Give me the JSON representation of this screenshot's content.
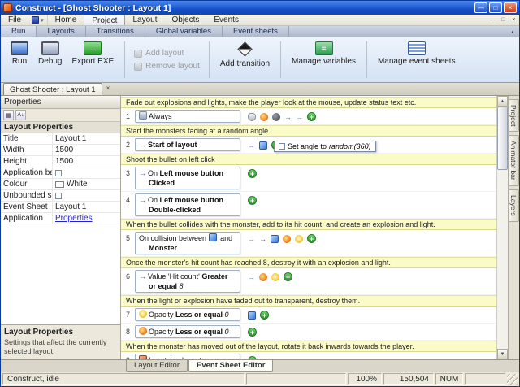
{
  "window": {
    "title": "Construct - [Ghost Shooter : Layout 1]"
  },
  "menu": {
    "items": [
      "File",
      "Home",
      "Project",
      "Layout",
      "Objects",
      "Events"
    ],
    "active_index": 2
  },
  "ribbon": {
    "groups": [
      "Run",
      "Layouts",
      "Transitions",
      "Global variables",
      "Event sheets"
    ],
    "buttons": [
      {
        "label": "Run",
        "icon": "run-icon"
      },
      {
        "label": "Debug",
        "icon": "debug-icon"
      },
      {
        "label": "Export EXE",
        "icon": "export-icon"
      },
      {
        "label": "Add layout",
        "icon": "add-layout-icon",
        "disabled": true
      },
      {
        "label": "Remove layout",
        "icon": "remove-layout-icon",
        "disabled": true
      },
      {
        "label": "Add transition",
        "icon": "transition-icon"
      },
      {
        "label": "Manage variables",
        "icon": "variables-icon"
      },
      {
        "label": "Manage event sheets",
        "icon": "event-sheets-icon"
      }
    ]
  },
  "doc_tab": {
    "label": "Ghost Shooter : Layout 1"
  },
  "properties": {
    "title": "Properties",
    "group_header": "Layout Properties",
    "rows": [
      {
        "name": "Title",
        "kind": "text",
        "value": "Layout 1"
      },
      {
        "name": "Width",
        "kind": "text",
        "value": "1500"
      },
      {
        "name": "Height",
        "kind": "text",
        "value": "1500"
      },
      {
        "name": "Application backg",
        "kind": "check",
        "checked": false
      },
      {
        "name": "Colour",
        "kind": "color",
        "value": "White",
        "swatch": "#ffffff"
      },
      {
        "name": "Unbounded scrolli",
        "kind": "check",
        "checked": false
      },
      {
        "name": "Event Sheet",
        "kind": "text",
        "value": "Layout 1"
      },
      {
        "name": "Application",
        "kind": "link",
        "value": "Properties"
      }
    ],
    "footer_title": "Layout Properties",
    "footer_desc": "Settings that affect the currently selected layout"
  },
  "events": [
    {
      "kind": "comment",
      "text": "Fade out explosions and lights, make the player look at the mouse, update status text etc."
    },
    {
      "kind": "event",
      "num": "1",
      "lines": [
        [
          {
            "icon": "system-icon"
          },
          {
            "t": "Always"
          }
        ]
      ],
      "actions": [
        "mouse-icon",
        "explosion-icon",
        "ball-icon",
        "arrow-icon",
        "arrow-icon"
      ]
    },
    {
      "kind": "comment",
      "text": "Start the monsters facing at a random angle."
    },
    {
      "kind": "event",
      "num": "2",
      "lines": [
        [
          {
            "icon": "arrow-icon"
          },
          {
            "t": "Start of layout",
            "b": true
          }
        ]
      ],
      "actions": [
        "arrow-icon",
        "sprite-icon"
      ],
      "popup": {
        "text_parts": [
          {
            "t": "Set angle to "
          },
          {
            "t": "random(360)",
            "i": true
          }
        ]
      }
    },
    {
      "kind": "comment",
      "text": "Shoot the bullet on left click"
    },
    {
      "kind": "event",
      "num": "3",
      "lines": [
        [
          {
            "icon": "arrow-icon"
          },
          {
            "t": "On "
          },
          {
            "t": "Left mouse button",
            "b": true
          }
        ],
        [
          {
            "t": "Clicked",
            "b": true
          }
        ]
      ],
      "actions": []
    },
    {
      "kind": "event",
      "num": "4",
      "lines": [
        [
          {
            "icon": "arrow-icon"
          },
          {
            "t": "On "
          },
          {
            "t": "Left mouse button",
            "b": true
          }
        ],
        [
          {
            "t": "Double-clicked",
            "b": true
          }
        ]
      ],
      "actions": []
    },
    {
      "kind": "comment",
      "text": "When the bullet collides with the monster, add to its hit count, and create an explosion and light."
    },
    {
      "kind": "event",
      "num": "5",
      "lines": [
        [
          {
            "t": "On collision between "
          },
          {
            "icon": "sprite-icon"
          },
          {
            "t": " and"
          }
        ],
        [
          {
            "t": "Monster",
            "b": true
          }
        ]
      ],
      "actions": [
        "arrow-icon",
        "arrow-icon",
        "sprite-icon",
        "explosion-icon",
        "light-icon"
      ]
    },
    {
      "kind": "comment",
      "text": "Once the monster's hit count has reached 8, destroy it with an explosion and light."
    },
    {
      "kind": "event",
      "num": "6",
      "lines": [
        [
          {
            "icon": "arrow-icon"
          },
          {
            "t": "Value 'Hit count' "
          },
          {
            "t": "Greater",
            "b": true
          }
        ],
        [
          {
            "t": "or equal ",
            "b": true
          },
          {
            "t": "8",
            "i": true
          }
        ]
      ],
      "actions": [
        "arrow-icon",
        "explosion-icon",
        "light-icon"
      ]
    },
    {
      "kind": "comment",
      "text": "When the light or explosion have faded out to transparent, destroy them."
    },
    {
      "kind": "event",
      "num": "7",
      "lines": [
        [
          {
            "icon": "light-icon"
          },
          {
            "t": "Opacity "
          },
          {
            "t": "Less or equal",
            "b": true
          },
          {
            "t": " 0",
            "i": true
          }
        ]
      ],
      "actions": [
        "sprite-icon"
      ]
    },
    {
      "kind": "event",
      "num": "8",
      "lines": [
        [
          {
            "icon": "explosion-icon"
          },
          {
            "t": "Opacity "
          },
          {
            "t": "Less or equal",
            "b": true
          },
          {
            "t": " 0",
            "i": true
          }
        ]
      ],
      "actions": []
    },
    {
      "kind": "comment",
      "text": "When the monster has moved out of the layout, rotate it back inwards towards the player."
    },
    {
      "kind": "event",
      "num": "9",
      "lines": [
        [
          {
            "icon": "monster-icon"
          },
          {
            "t": "Is outside layout"
          }
        ]
      ],
      "actions": []
    }
  ],
  "side_tabs": [
    {
      "label": "Project"
    },
    {
      "label": "Animator bar"
    },
    {
      "label": "Layers"
    }
  ],
  "bottom_tabs": [
    {
      "label": "Layout Editor"
    },
    {
      "label": "Event Sheet Editor",
      "active": true
    }
  ],
  "status": {
    "message": "Construct, idle",
    "zoom": "100%",
    "coords": "150,504",
    "num_lock": "NUM"
  },
  "icons": {
    "minimize": "—",
    "maximize": "□",
    "close": "×",
    "chevron_down": "▾",
    "collapse": "▴",
    "scroll_up": "▲",
    "scroll_down": "▼",
    "grid": "▦",
    "sort": "A↓",
    "plus": "+",
    "arrow": "→"
  },
  "colors": {
    "titlebar_blue": "#1450c8",
    "comment_bg": "#fbfbc8",
    "add_button_green": "#2f8f2f",
    "link_blue": "#2222cc"
  }
}
